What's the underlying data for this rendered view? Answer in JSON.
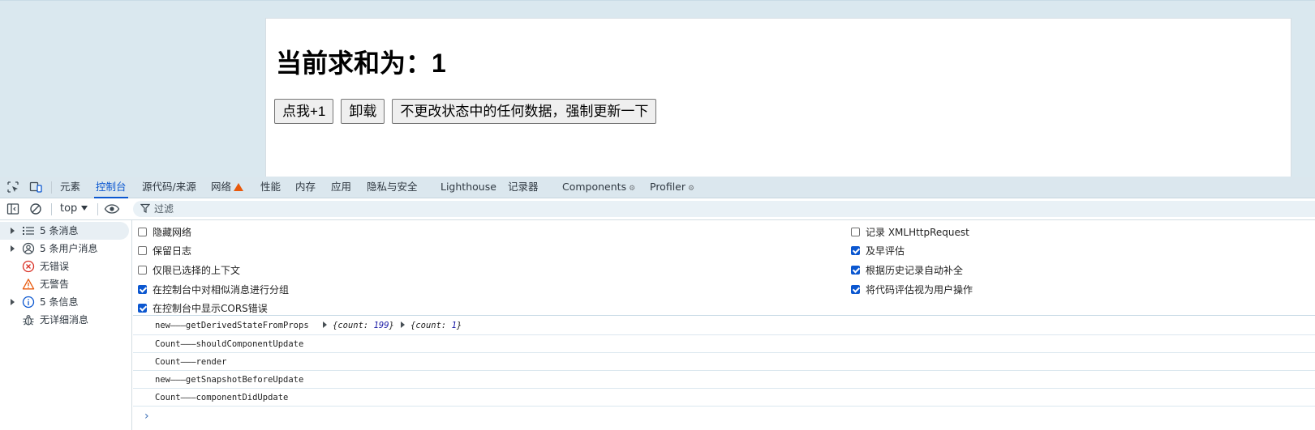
{
  "page": {
    "title": "当前求和为：1",
    "buttons": {
      "add": "点我+1",
      "unmount": "卸载",
      "force_update": "不更改状态中的任何数据，强制更新一下"
    }
  },
  "devtools": {
    "tabs": [
      {
        "label": "元素"
      },
      {
        "label": "控制台",
        "active": true
      },
      {
        "label": "源代码/来源"
      },
      {
        "label": "网络",
        "warning": true
      },
      {
        "label": "性能"
      },
      {
        "label": "内存"
      },
      {
        "label": "应用"
      },
      {
        "label": "隐私与安全"
      },
      {
        "label": "Lighthouse"
      },
      {
        "label": "记录器"
      },
      {
        "label": "Components",
        "gear": true
      },
      {
        "label": "Profiler",
        "gear": true
      }
    ],
    "toolbar": {
      "context": "top",
      "filter_placeholder": "过滤"
    },
    "sidebar": {
      "items": [
        {
          "label": "5 条消息",
          "icon": "list-icon"
        },
        {
          "label": "5 条用户消息",
          "icon": "user-icon"
        },
        {
          "label": "无错误",
          "icon": "error-icon"
        },
        {
          "label": "无警告",
          "icon": "warning-icon"
        },
        {
          "label": "5 条信息",
          "icon": "info-icon"
        },
        {
          "label": "无详细消息",
          "icon": "bug-icon"
        }
      ]
    },
    "settings": {
      "left": [
        {
          "label": "隐藏网络",
          "checked": false
        },
        {
          "label": "保留日志",
          "checked": false
        },
        {
          "label": "仅限已选择的上下文",
          "checked": false
        },
        {
          "label": "在控制台中对相似消息进行分组",
          "checked": true
        },
        {
          "label": "在控制台中显示CORS错误",
          "checked": true
        }
      ],
      "right": [
        {
          "label": "记录 XMLHttpRequest",
          "checked": false
        },
        {
          "label": "及早评估",
          "checked": true
        },
        {
          "label": "根据历史记录自动补全",
          "checked": true
        },
        {
          "label": "将代码评估视为用户操作",
          "checked": true
        }
      ]
    },
    "console": {
      "messages": [
        {
          "text": "new———getDerivedStateFromProps",
          "obj1_prefix": "{count: ",
          "obj1_value": "199",
          "obj1_suffix": "}",
          "obj2_prefix": "{count: ",
          "obj2_value": "1",
          "obj2_suffix": "}"
        },
        {
          "text": "Count———shouldComponentUpdate"
        },
        {
          "text": "Count———render"
        },
        {
          "text": "new———getSnapshotBeforeUpdate"
        },
        {
          "text": "Count———componentDidUpdate"
        }
      ],
      "prompt": "›"
    }
  }
}
